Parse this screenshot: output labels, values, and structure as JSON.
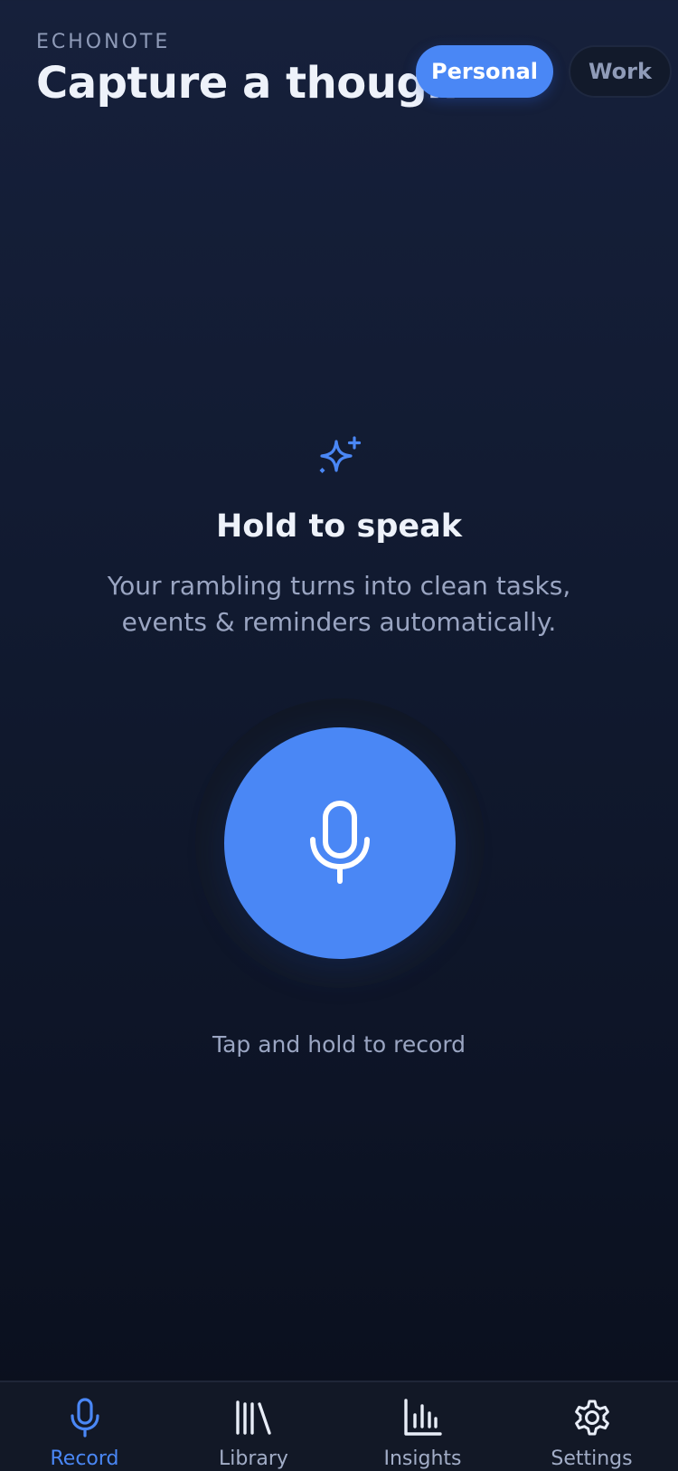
{
  "header": {
    "brand": "ECHONOTE",
    "title": "Capture a thought",
    "modes": [
      {
        "label": "Personal",
        "active": true
      },
      {
        "label": "Work",
        "active": false
      }
    ]
  },
  "hero": {
    "icon": "sparkle-icon",
    "title": "Hold to speak",
    "subtitle_line1": "Your rambling turns into clean tasks,",
    "subtitle_line2": "events & reminders automatically."
  },
  "record": {
    "icon": "microphone-icon",
    "hint": "Tap and hold to record"
  },
  "tabbar": {
    "tabs": [
      {
        "label": "Record",
        "icon": "microphone-icon",
        "active": true
      },
      {
        "label": "Library",
        "icon": "library-icon",
        "active": false
      },
      {
        "label": "Insights",
        "icon": "bar-chart-icon",
        "active": false
      },
      {
        "label": "Settings",
        "icon": "gear-icon",
        "active": false
      }
    ]
  },
  "colors": {
    "accent": "#4a87f5",
    "background_top": "#16203b",
    "background_bottom": "#0a0f1c",
    "text_primary": "#eef2fa",
    "text_secondary": "#9aa5c2"
  }
}
